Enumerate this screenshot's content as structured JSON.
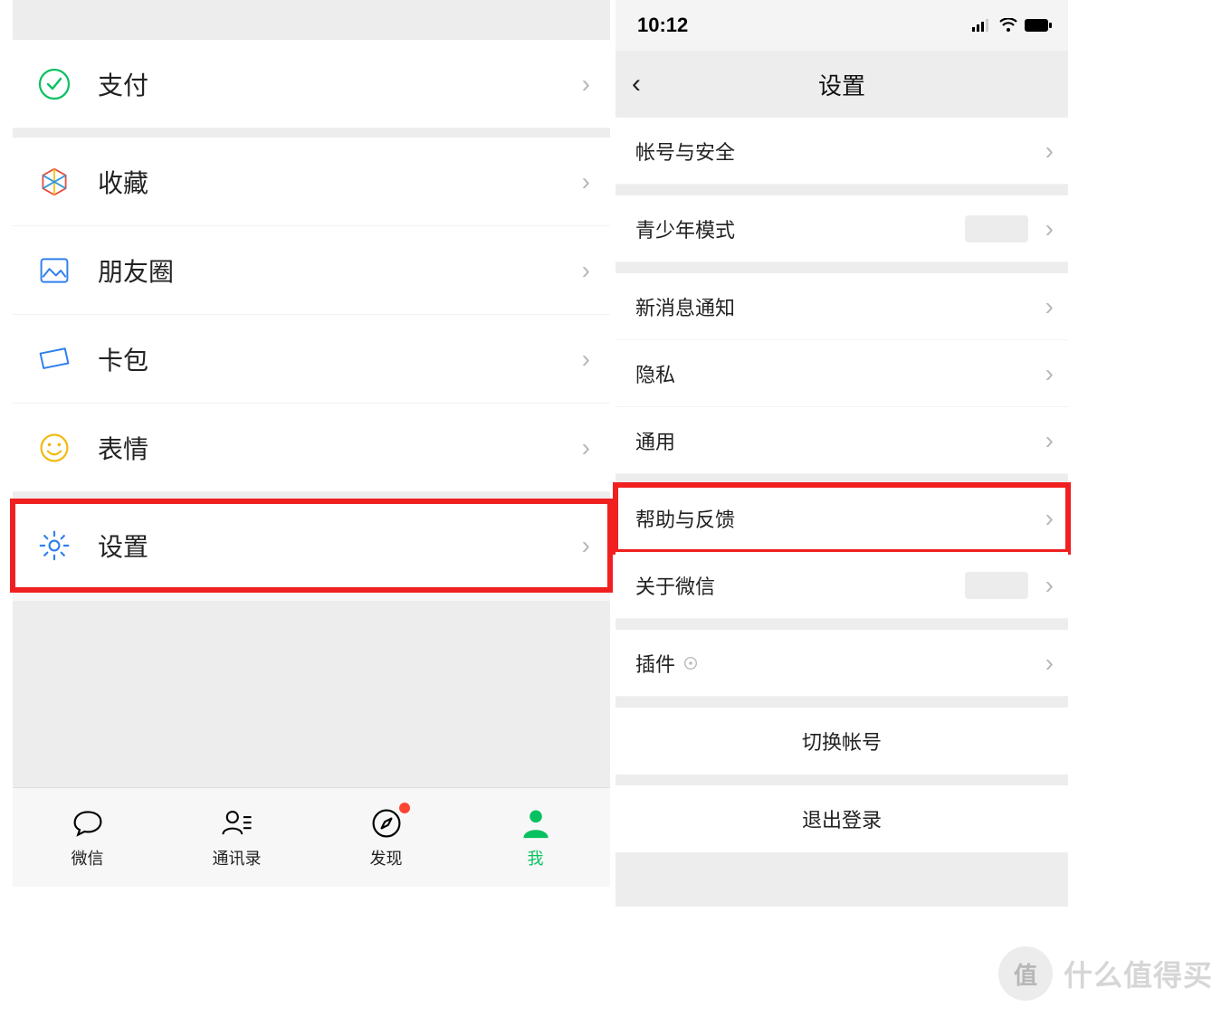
{
  "left": {
    "menu": {
      "pay": "支付",
      "favorites": "收藏",
      "moments": "朋友圈",
      "cards": "卡包",
      "stickers": "表情",
      "settings": "设置"
    },
    "tabs": {
      "chat": "微信",
      "contacts": "通讯录",
      "discover": "发现",
      "me": "我"
    }
  },
  "right": {
    "status_time": "10:12",
    "nav_title": "设置",
    "items": {
      "account_security": "帐号与安全",
      "youth_mode": "青少年模式",
      "new_msg": "新消息通知",
      "privacy": "隐私",
      "general": "通用",
      "help_feedback": "帮助与反馈",
      "about": "关于微信",
      "plugins": "插件",
      "switch_account": "切换帐号",
      "logout": "退出登录"
    }
  },
  "watermark": {
    "badge": "值",
    "text": "什么值得买"
  }
}
